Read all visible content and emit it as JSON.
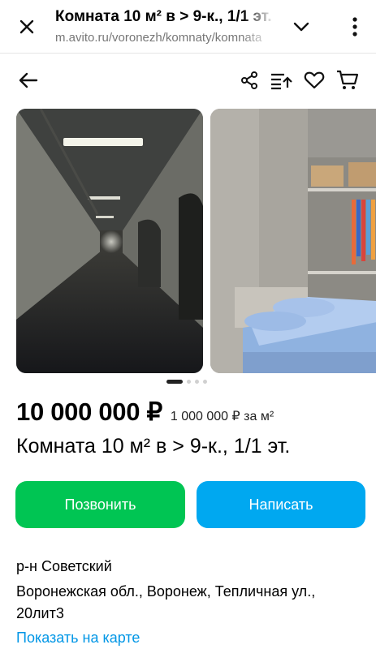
{
  "browser": {
    "title": "Комната 10 м² в > 9-к., 1/1 эт.",
    "url": "m.avito.ru/voronezh/komnaty/komnata"
  },
  "toolbar": {
    "icons": [
      "share-icon",
      "compare-icon",
      "heart-icon",
      "cart-icon"
    ]
  },
  "gallery": {
    "photos": [
      "corridor-photo",
      "bedroom-photo"
    ],
    "page_count": 4,
    "current_page": 1
  },
  "listing": {
    "price": "10 000 000 ₽",
    "price_per_sqm": "1 000 000 ₽ за м²",
    "title": "Комната 10 м² в > 9-к., 1/1 эт."
  },
  "actions": {
    "call_label": "Позвонить",
    "write_label": "Написать"
  },
  "location": {
    "district": "р-н Советский",
    "address": "Воронежская обл., Воронеж, Тепличная ул., 20лит3",
    "map_link": "Показать на карте"
  },
  "colors": {
    "call_button": "#00c553",
    "write_button": "#00a8f0",
    "link": "#0096e6"
  }
}
